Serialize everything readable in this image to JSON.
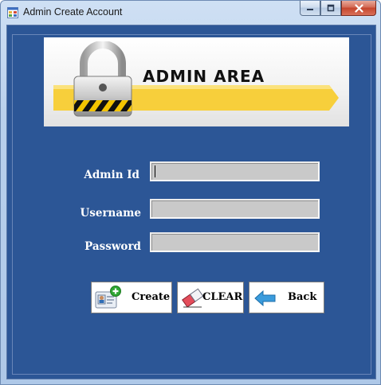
{
  "window": {
    "title": "Admin Create Account"
  },
  "banner": {
    "text": "ADMIN AREA"
  },
  "form": {
    "admin_id_label": "Admin Id",
    "username_label": "Username",
    "password_label": "Password",
    "admin_id_value": "",
    "username_value": "",
    "password_value": ""
  },
  "buttons": {
    "create_label": "Create",
    "clear_label": "CLEAR",
    "back_label": "Back"
  },
  "colors": {
    "client_background": "#2c5696",
    "field_background": "#c9c9c9",
    "banner_stripe": "#f7cf3b"
  },
  "icons": {
    "app": "form-icon",
    "minimize": "minimize-icon",
    "maximize": "maximize-icon",
    "close": "close-icon",
    "banner": "padlock-icon",
    "create": "add-user-icon",
    "clear": "eraser-icon",
    "back": "back-arrow-icon"
  }
}
